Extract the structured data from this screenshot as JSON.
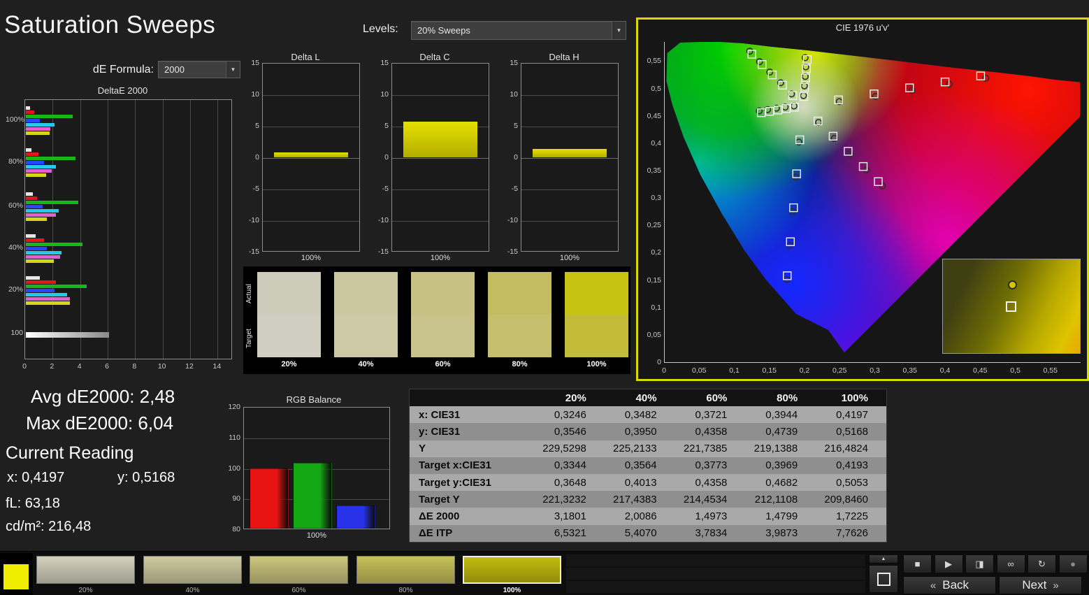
{
  "header": {
    "title": "Saturation Sweeps",
    "de_formula_label": "dE Formula:",
    "de_formula_value": "2000",
    "levels_label": "Levels:",
    "levels_value": "20% Sweeps",
    "chevron_down": "▼"
  },
  "stats": {
    "avg": "Avg dE2000: 2,48",
    "max": "Max dE2000: 6,04",
    "current_heading": "Current Reading",
    "x": "x: 0,4197",
    "y": "y: 0,5168",
    "fl": "fL: 63,18",
    "cd": "cd/m²: 216,48"
  },
  "swatch_strip": {
    "actual_label": "Actual",
    "target_label": "Target",
    "levels": [
      "20%",
      "40%",
      "60%",
      "80%",
      "100%"
    ],
    "actual_colors": [
      "#cdcbb9",
      "#cbc79e",
      "#c7c183",
      "#c3bc60",
      "#c8c212"
    ],
    "target_colors": [
      "#d0cec0",
      "#cdc9a6",
      "#c9c48d",
      "#c5bf6e",
      "#c2bc3a"
    ]
  },
  "table": {
    "col_headers": [
      "20%",
      "40%",
      "60%",
      "80%",
      "100%"
    ],
    "rows": [
      {
        "label": "x: CIE31",
        "values": [
          "0,3246",
          "0,3482",
          "0,3721",
          "0,3944",
          "0,4197"
        ]
      },
      {
        "label": "y: CIE31",
        "values": [
          "0,3546",
          "0,3950",
          "0,4358",
          "0,4739",
          "0,5168"
        ]
      },
      {
        "label": "Y",
        "values": [
          "229,5298",
          "225,2133",
          "221,7385",
          "219,1388",
          "216,4824"
        ]
      },
      {
        "label": "Target x:CIE31",
        "values": [
          "0,3344",
          "0,3564",
          "0,3773",
          "0,3969",
          "0,4193"
        ]
      },
      {
        "label": "Target y:CIE31",
        "values": [
          "0,3648",
          "0,4013",
          "0,4358",
          "0,4682",
          "0,5053"
        ]
      },
      {
        "label": "Target Y",
        "values": [
          "221,3232",
          "217,4383",
          "214,4534",
          "212,1108",
          "209,8460"
        ]
      },
      {
        "label": "ΔE 2000",
        "values": [
          "3,1801",
          "2,0086",
          "1,4973",
          "1,4799",
          "1,7225"
        ]
      },
      {
        "label": "ΔE ITP",
        "values": [
          "6,5321",
          "5,4070",
          "3,7834",
          "3,9873",
          "7,7626"
        ]
      }
    ]
  },
  "chart_data": [
    {
      "id": "deltae",
      "type": "bar",
      "orientation": "horizontal",
      "title": "DeltaE 2000",
      "xlim": [
        0,
        15
      ],
      "xticks": [
        0,
        2,
        4,
        6,
        8,
        10,
        12,
        14
      ],
      "series_colors": {
        "white": "#e6e6e6",
        "red": "#e01818",
        "green": "#18b818",
        "blue": "#2846ff",
        "cyan": "#28c8e8",
        "magenta": "#e060d0",
        "yellow": "#d6d618",
        "gray": "#cccccc"
      },
      "groups": [
        {
          "label": "100%",
          "bars": [
            [
              "white",
              0.3
            ],
            [
              "red",
              0.6
            ],
            [
              "green",
              3.4
            ],
            [
              "blue",
              1.0
            ],
            [
              "cyan",
              2.1
            ],
            [
              "magenta",
              1.8
            ],
            [
              "yellow",
              1.72
            ]
          ]
        },
        {
          "label": "80%",
          "bars": [
            [
              "white",
              0.4
            ],
            [
              "red",
              0.9
            ],
            [
              "green",
              3.6
            ],
            [
              "blue",
              1.3
            ],
            [
              "cyan",
              2.2
            ],
            [
              "magenta",
              1.9
            ],
            [
              "yellow",
              1.48
            ]
          ]
        },
        {
          "label": "60%",
          "bars": [
            [
              "white",
              0.5
            ],
            [
              "red",
              0.8
            ],
            [
              "green",
              3.8
            ],
            [
              "blue",
              1.2
            ],
            [
              "cyan",
              2.4
            ],
            [
              "magenta",
              2.2
            ],
            [
              "yellow",
              1.5
            ]
          ]
        },
        {
          "label": "40%",
          "bars": [
            [
              "white",
              0.7
            ],
            [
              "red",
              1.3
            ],
            [
              "green",
              4.1
            ],
            [
              "blue",
              1.5
            ],
            [
              "cyan",
              2.6
            ],
            [
              "magenta",
              2.5
            ],
            [
              "yellow",
              2.01
            ]
          ]
        },
        {
          "label": "20%",
          "bars": [
            [
              "white",
              1.0
            ],
            [
              "red",
              2.2
            ],
            [
              "green",
              4.4
            ],
            [
              "blue",
              2.1
            ],
            [
              "cyan",
              3.0
            ],
            [
              "magenta",
              3.2
            ],
            [
              "yellow",
              3.18
            ]
          ]
        },
        {
          "label": "100",
          "bars": [
            [
              "gray",
              6.04
            ]
          ]
        }
      ]
    },
    {
      "id": "delta_l",
      "type": "bar",
      "title": "Delta L",
      "ylim": [
        -15,
        15
      ],
      "yticks": [
        15,
        10,
        5,
        0,
        -5,
        -10,
        -15
      ],
      "categories": [
        "100%"
      ],
      "values": [
        0.8
      ],
      "bar_color": "#d4ce00"
    },
    {
      "id": "delta_c",
      "type": "bar",
      "title": "Delta C",
      "ylim": [
        -15,
        15
      ],
      "yticks": [
        15,
        10,
        5,
        0,
        -5,
        -10,
        -15
      ],
      "categories": [
        "100%"
      ],
      "values": [
        5.7
      ],
      "bar_color": "#d4ce00"
    },
    {
      "id": "delta_h",
      "type": "bar",
      "title": "Delta H",
      "ylim": [
        -15,
        15
      ],
      "yticks": [
        15,
        10,
        5,
        0,
        -5,
        -10,
        -15
      ],
      "categories": [
        "100%"
      ],
      "values": [
        1.3
      ],
      "bar_color": "#d4ce00"
    },
    {
      "id": "rgb_balance",
      "type": "bar",
      "title": "RGB Balance",
      "ylim": [
        80,
        120
      ],
      "yticks": [
        120,
        110,
        100,
        90,
        80
      ],
      "categories": [
        "100%"
      ],
      "series": [
        {
          "name": "Red",
          "color": "#e81414",
          "value": 99.6
        },
        {
          "name": "Green",
          "color": "#14a814",
          "value": 101.4
        },
        {
          "name": "Blue",
          "color": "#2832e8",
          "value": 87.6
        }
      ]
    },
    {
      "id": "cie",
      "type": "scatter",
      "title": "CIE 1976 u'v'",
      "xlim": [
        0,
        0.592
      ],
      "ylim": [
        0,
        0.585
      ],
      "ticks": [
        0,
        0.05,
        0.1,
        0.15,
        0.2,
        0.25,
        0.3,
        0.35,
        0.4,
        0.45,
        0.5,
        0.55
      ],
      "targets": [
        [
          0.2484,
          0.4792
        ],
        [
          0.299,
          0.4901
        ],
        [
          0.3495,
          0.5011
        ],
        [
          0.4001,
          0.512
        ],
        [
          0.4507,
          0.5229
        ],
        [
          0.1832,
          0.4871
        ],
        [
          0.1687,
          0.506
        ],
        [
          0.1541,
          0.5248
        ],
        [
          0.1396,
          0.5437
        ],
        [
          0.125,
          0.5625
        ],
        [
          0.1933,
          0.4062
        ],
        [
          0.1888,
          0.3441
        ],
        [
          0.1844,
          0.2821
        ],
        [
          0.1799,
          0.22
        ],
        [
          0.1754,
          0.1579
        ],
        [
          0.1859,
          0.4658
        ],
        [
          0.1741,
          0.4633
        ],
        [
          0.1622,
          0.4607
        ],
        [
          0.1504,
          0.4582
        ],
        [
          0.1385,
          0.4557
        ],
        [
          0.2192,
          0.4406
        ],
        [
          0.2407,
          0.4129
        ],
        [
          0.2621,
          0.3852
        ],
        [
          0.2836,
          0.3575
        ],
        [
          0.305,
          0.3298
        ],
        [
          0.199,
          0.4852
        ],
        [
          0.2002,
          0.5021
        ],
        [
          0.2015,
          0.5191
        ],
        [
          0.2027,
          0.536
        ],
        [
          0.2039,
          0.5529
        ]
      ],
      "measurements": [
        [
          0.2495,
          0.476
        ],
        [
          0.301,
          0.4855
        ],
        [
          0.353,
          0.4965
        ],
        [
          0.406,
          0.508
        ],
        [
          0.458,
          0.519
        ],
        [
          0.1815,
          0.49
        ],
        [
          0.166,
          0.5105
        ],
        [
          0.1505,
          0.53
        ],
        [
          0.136,
          0.549
        ],
        [
          0.122,
          0.568
        ],
        [
          0.192,
          0.402
        ],
        [
          0.187,
          0.338
        ],
        [
          0.183,
          0.275
        ],
        [
          0.179,
          0.213
        ],
        [
          0.175,
          0.151
        ],
        [
          0.185,
          0.468
        ],
        [
          0.1725,
          0.466
        ],
        [
          0.16,
          0.464
        ],
        [
          0.1475,
          0.4615
        ],
        [
          0.1355,
          0.459
        ],
        [
          0.22,
          0.438
        ],
        [
          0.2425,
          0.409
        ],
        [
          0.265,
          0.38
        ],
        [
          0.288,
          0.351
        ],
        [
          0.311,
          0.322
        ],
        [
          0.1985,
          0.487
        ],
        [
          0.1998,
          0.5048
        ],
        [
          0.201,
          0.522
        ],
        [
          0.2018,
          0.5395
        ],
        [
          0.2008,
          0.5562
        ]
      ],
      "inset": {
        "circle_pos": [
          93,
          30
        ],
        "square_pos": [
          90,
          60
        ]
      }
    }
  ],
  "bottom": {
    "current_patch_color": "#f0ee00",
    "patches": [
      {
        "label": "20%",
        "color": "#d3d1bd",
        "selected": false
      },
      {
        "label": "40%",
        "color": "#cfcba0",
        "selected": false
      },
      {
        "label": "60%",
        "color": "#cbc67e",
        "selected": false
      },
      {
        "label": "80%",
        "color": "#c6c05a",
        "selected": false
      },
      {
        "label": "100%",
        "color": "#c3bc0e",
        "selected": true
      }
    ],
    "up_glyph": "▲",
    "icon_buttons": [
      {
        "name": "stop-icon",
        "glyph": "■"
      },
      {
        "name": "play-icon",
        "glyph": "▶"
      },
      {
        "name": "step-icon",
        "glyph": "◨"
      },
      {
        "name": "infinity-icon",
        "glyph": "∞"
      },
      {
        "name": "refresh-icon",
        "glyph": "↻"
      },
      {
        "name": "record-icon",
        "glyph": "●"
      }
    ],
    "back_chevron": "«",
    "back_label": "Back",
    "next_label": "Next",
    "next_chevron": "»"
  }
}
